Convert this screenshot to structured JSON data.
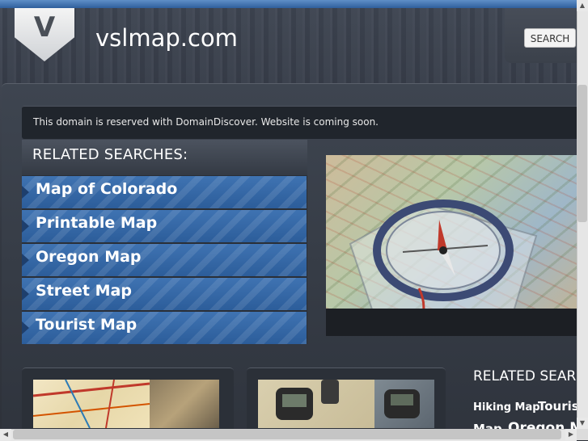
{
  "header": {
    "logo_letter": "V",
    "site_title": "vslmap.com",
    "search_label": "SEARCH"
  },
  "notice": {
    "text": "This domain is reserved with DomainDiscover. Website is coming soon."
  },
  "related": {
    "title": "RELATED SEARCHES:",
    "items": [
      {
        "label": "Map of Colorado"
      },
      {
        "label": "Printable Map"
      },
      {
        "label": "Oregon Map"
      },
      {
        "label": "Street Map"
      },
      {
        "label": "Tourist Map"
      }
    ]
  },
  "right_panel": {
    "heading": "RELATED SEAR",
    "tags": [
      "Hiking Map",
      "Tourist",
      "Map",
      "Oregon M"
    ]
  },
  "colors": {
    "accent_blue": "#3f73b2",
    "top_line": "#2f5f9c",
    "background": "#2b303a"
  },
  "icons": {
    "scroll_up": "▲",
    "scroll_down": "▼",
    "scroll_left": "◀",
    "scroll_right": "▶"
  }
}
